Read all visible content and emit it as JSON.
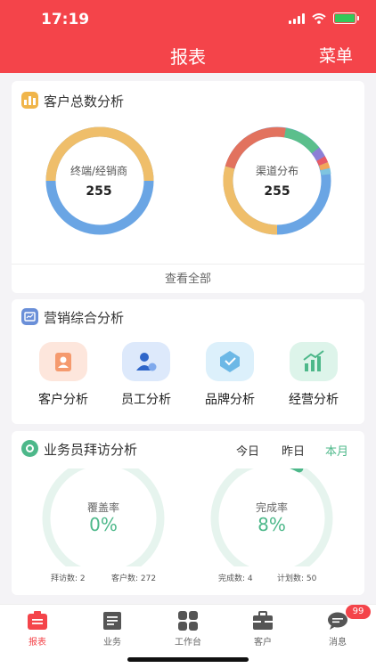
{
  "status_bar": {
    "time": "17:19"
  },
  "header": {
    "title": "报表",
    "menu": "菜单"
  },
  "customer_analysis": {
    "title": "客户总数分析",
    "rings": [
      {
        "label": "终端/经销商",
        "value": "255"
      },
      {
        "label": "渠道分布",
        "value": "255"
      }
    ],
    "view_all": "查看全部"
  },
  "marketing": {
    "title": "营销综合分析",
    "entries": [
      {
        "label": "客户分析",
        "icon": "customer-analysis-icon"
      },
      {
        "label": "员工分析",
        "icon": "employee-analysis-icon"
      },
      {
        "label": "品牌分析",
        "icon": "brand-analysis-icon"
      },
      {
        "label": "经营分析",
        "icon": "business-analysis-icon"
      }
    ]
  },
  "visit_analysis": {
    "title": "业务员拜访分析",
    "periods": [
      "今日",
      "昨日",
      "本月"
    ],
    "selected_period": "本月",
    "coverage": {
      "label": "覆盖率",
      "value": "0%",
      "fraction": 0
    },
    "completion": {
      "label": "完成率",
      "value": "8%",
      "fraction": 0.08
    },
    "stats": {
      "visits": "拜访数: 2",
      "customers": "客户数: 272",
      "completed": "完成数: 4",
      "planned": "计划数: 50"
    }
  },
  "tabbar": {
    "items": [
      {
        "label": "报表",
        "icon": "report-icon",
        "active": true
      },
      {
        "label": "业务",
        "icon": "business-icon",
        "active": false
      },
      {
        "label": "工作台",
        "icon": "workbench-icon",
        "active": false
      },
      {
        "label": "客户",
        "icon": "customer-icon",
        "active": false
      },
      {
        "label": "消息",
        "icon": "message-icon",
        "active": false
      }
    ],
    "message_badge": "99"
  },
  "colors": {
    "brand_red": "#f4444a",
    "accent_green": "#4db88a",
    "ring_blue": "#6aa5e4",
    "ring_orange": "#efbe6a",
    "ring_red": "#e2725e"
  }
}
